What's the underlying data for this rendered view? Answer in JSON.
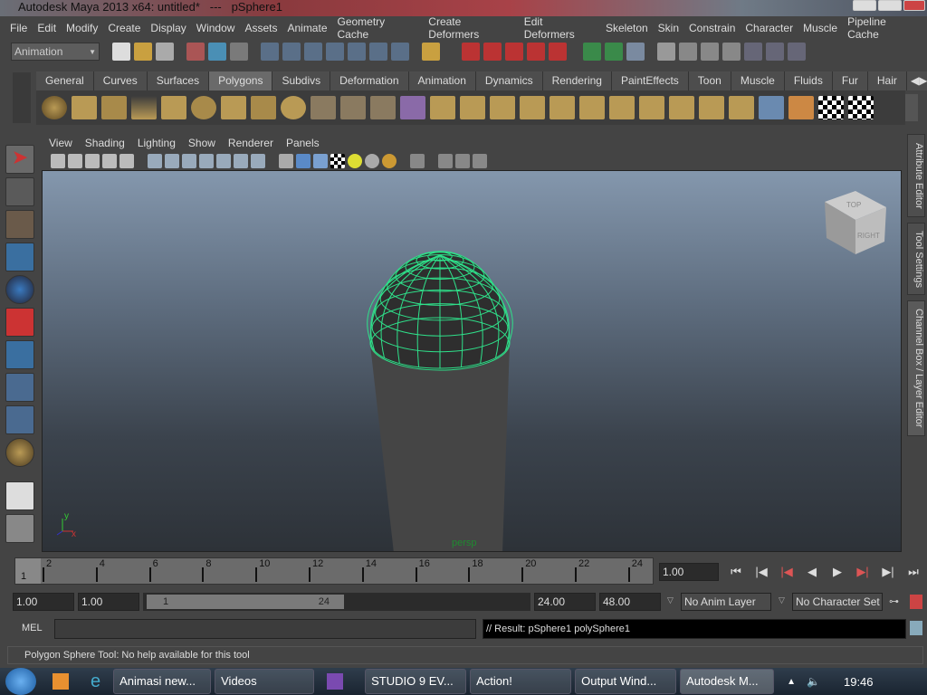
{
  "window": {
    "title": "Autodesk Maya 2013 x64: untitled*   ---   pSphere1"
  },
  "menu": [
    "File",
    "Edit",
    "Modify",
    "Create",
    "Display",
    "Window",
    "Assets",
    "Animate",
    "Geometry Cache",
    "Create Deformers",
    "Edit Deformers",
    "Skeleton",
    "Skin",
    "Constrain",
    "Character",
    "Muscle",
    "Pipeline Cache"
  ],
  "toolbar": {
    "menu_set": "Animation"
  },
  "shelf": {
    "tabs": [
      "General",
      "Curves",
      "Surfaces",
      "Polygons",
      "Subdivs",
      "Deformation",
      "Animation",
      "Dynamics",
      "Rendering",
      "PaintEffects",
      "Toon",
      "Muscle",
      "Fluids",
      "Fur",
      "Hair"
    ],
    "active": "Polygons"
  },
  "panel": {
    "menu": [
      "View",
      "Shading",
      "Lighting",
      "Show",
      "Renderer",
      "Panels"
    ],
    "camera_label": "persp",
    "viewcube_top": "TOP",
    "viewcube_right": "RIGHT",
    "axis_x": "x",
    "axis_y": "y"
  },
  "side_tabs": [
    "Attribute Editor",
    "Tool Settings",
    "Channel Box / Layer Editor"
  ],
  "timeline": {
    "ticks": [
      "2",
      "4",
      "6",
      "8",
      "10",
      "12",
      "14",
      "16",
      "18",
      "20",
      "22",
      "24"
    ],
    "current_marker": "1",
    "current_time": "1.00"
  },
  "range": {
    "start": "1.00",
    "playback_start": "1.00",
    "slider_start": "1",
    "slider_end": "24",
    "playback_end": "24.00",
    "end": "48.00",
    "anim_layer": "No Anim Layer",
    "character_set": "No Character Set"
  },
  "command": {
    "label": "MEL",
    "input": "",
    "result": "// Result: pSphere1 polySphere1"
  },
  "help_line": "Polygon Sphere Tool: No help available for this tool",
  "taskbar": {
    "items": [
      "Animasi new...",
      "Videos",
      "STUDIO 9 EV...",
      "Action!",
      "Output Wind...",
      "Autodesk M..."
    ],
    "clock": "19:46"
  }
}
